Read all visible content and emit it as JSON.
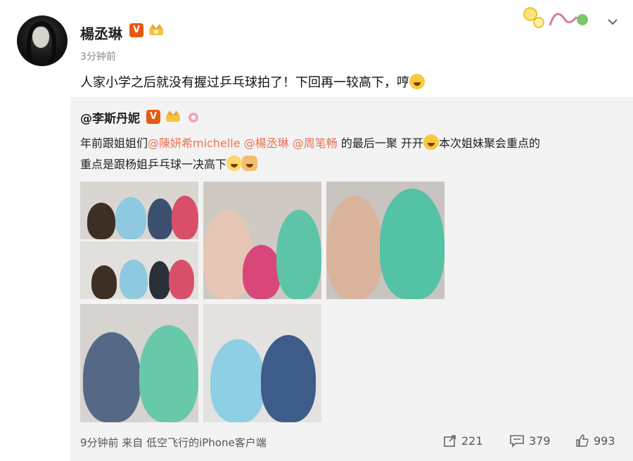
{
  "post": {
    "author": "楊丞琳",
    "time": "3分钟前",
    "text": "人家小学之后就没有握过乒乓球拍了！下回再一较高下，哼",
    "verified_badge": "V"
  },
  "repost": {
    "author": "@李斯丹妮",
    "verified_badge": "V",
    "line1_prefix": "年前跟姐姐们",
    "mention1": "@陳妍希michelle",
    "mention2": "@楊丞琳",
    "mention3": "@周笔畅",
    "line1_mid": " 的最后一聚 开开",
    "line1_suffix": "本次姐妹聚会重点的",
    "line2": "重点是跟杨姐乒乓球一决高下",
    "footer": {
      "time_source": "9分钟前 来自 低空飞行的iPhone客户端",
      "shares": "221",
      "comments": "379",
      "likes": "993"
    }
  },
  "colors": {
    "mention": "#eb7350",
    "badge": "#e8590c",
    "repost_bg": "#f3f3f3"
  },
  "icons": [
    "vlog-sticker",
    "chevron-down-icon",
    "share-icon",
    "comment-icon",
    "like-icon",
    "crying-emoji-icon"
  ]
}
